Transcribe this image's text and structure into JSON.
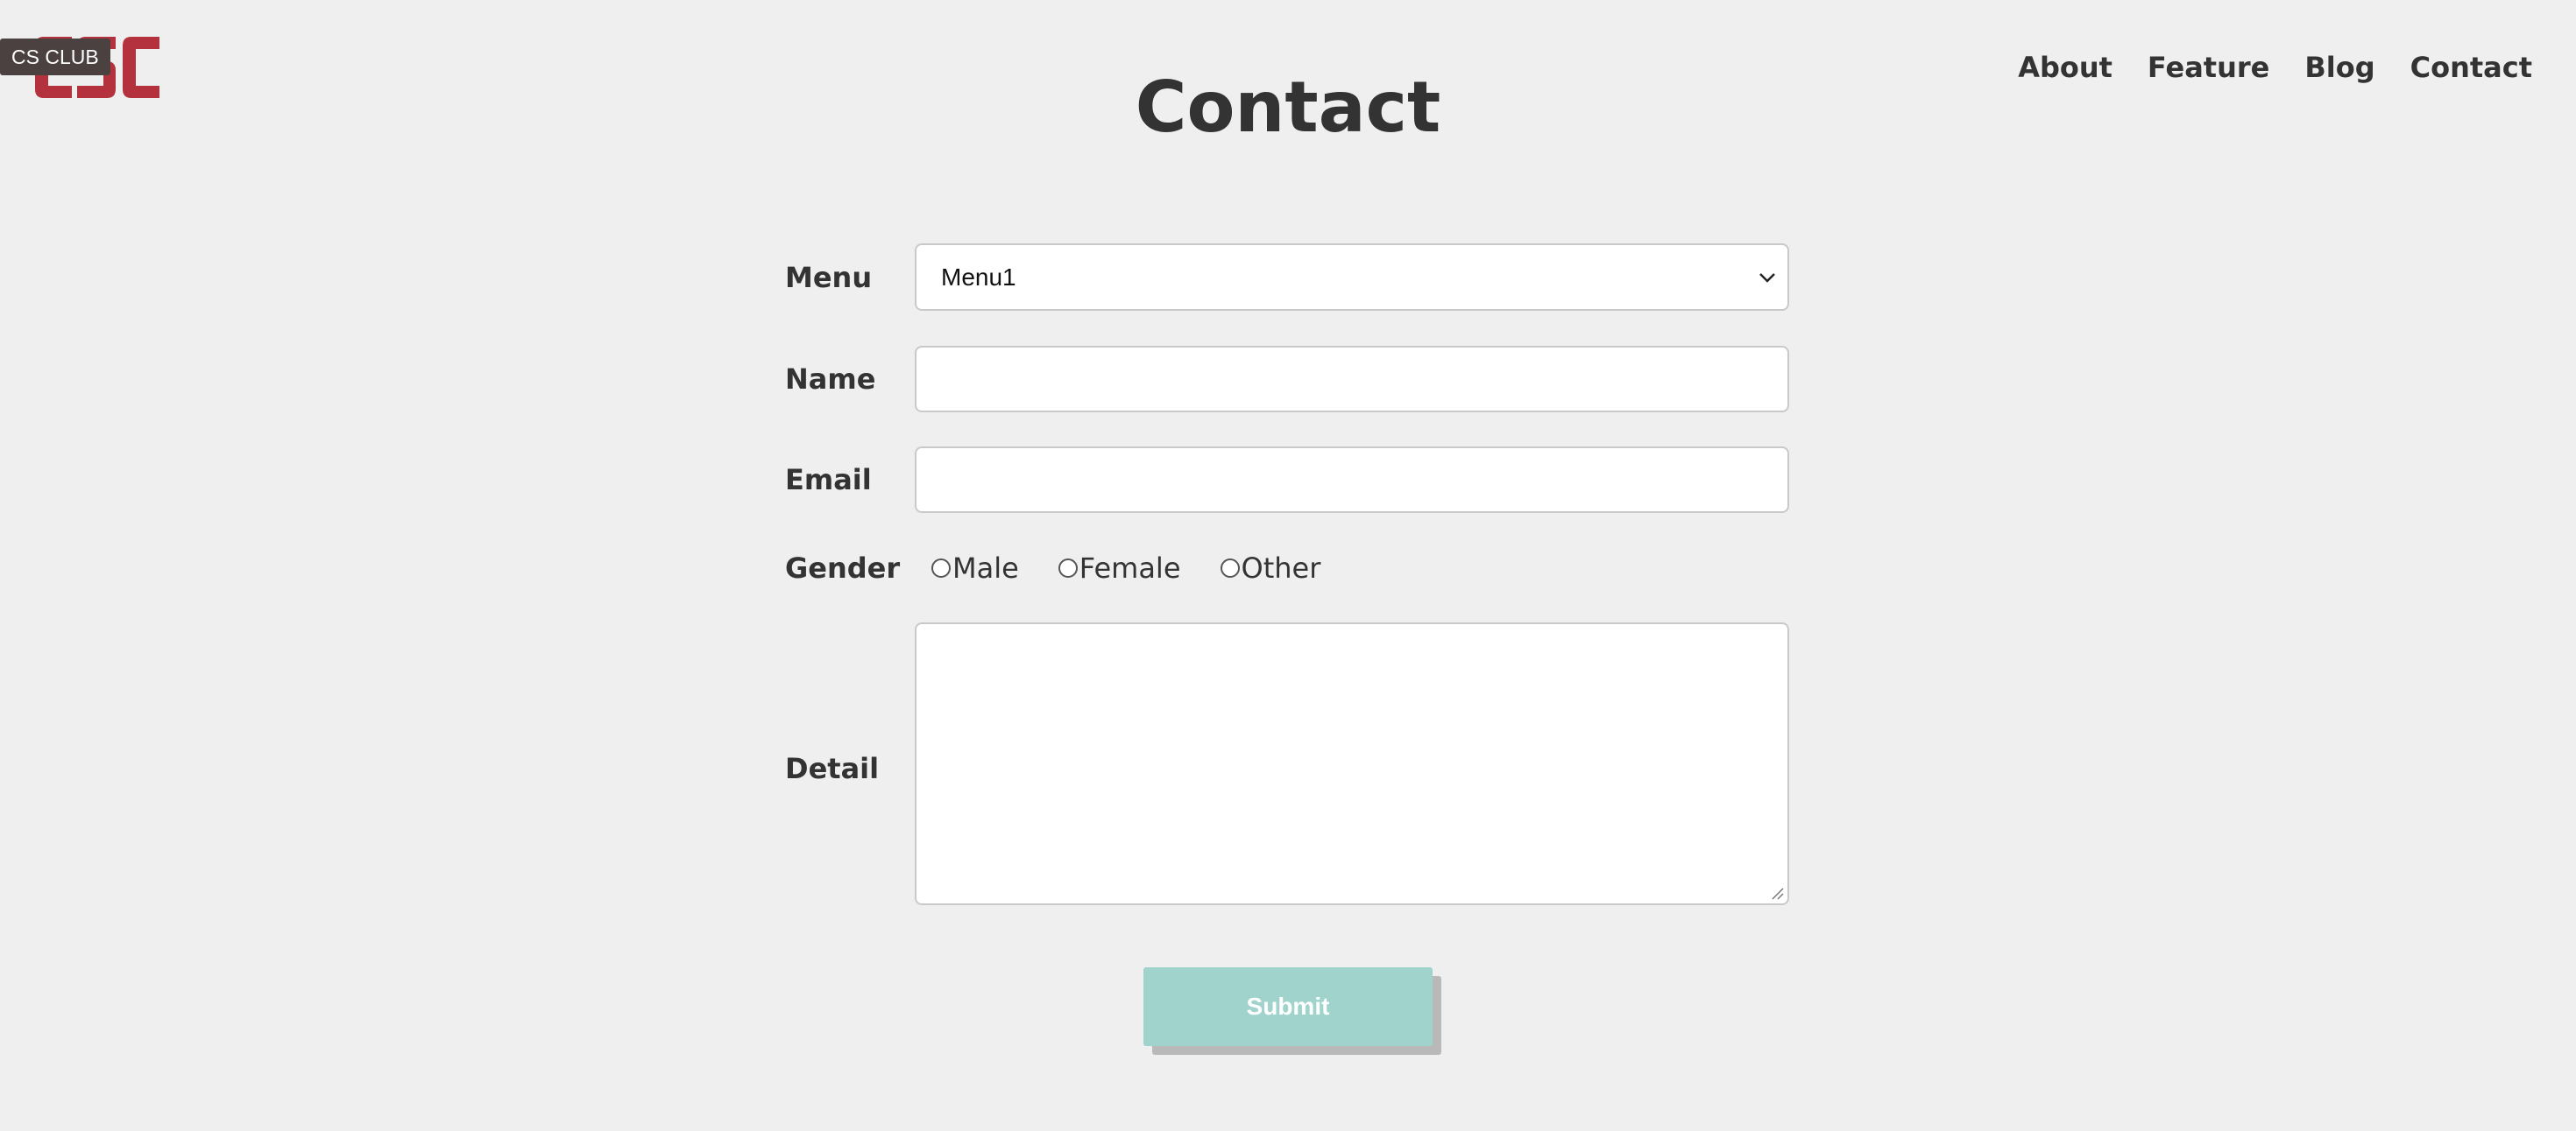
{
  "header": {
    "logo_tooltip": "CS CLUB",
    "title": "Contact",
    "nav": [
      "About",
      "Feature",
      "Blog",
      "Contact"
    ]
  },
  "form": {
    "menu_label": "Menu",
    "menu_selected": "Menu1",
    "name_label": "Name",
    "name_value": "",
    "email_label": "Email",
    "email_value": "",
    "gender_label": "Gender",
    "gender_options": [
      "Male",
      "Female",
      "Other"
    ],
    "detail_label": "Detail",
    "detail_value": "",
    "submit_label": "Submit"
  },
  "colors": {
    "background": "#efefef",
    "logo_red": "#b3323e",
    "submit_button": "#9fd3cc",
    "text": "#333333"
  },
  "icons": {
    "logo": "csc-logo-icon",
    "select_arrow": "chevron-down-icon",
    "textarea_resize": "resize-grip-icon",
    "radio": "radio-unchecked-icon"
  }
}
